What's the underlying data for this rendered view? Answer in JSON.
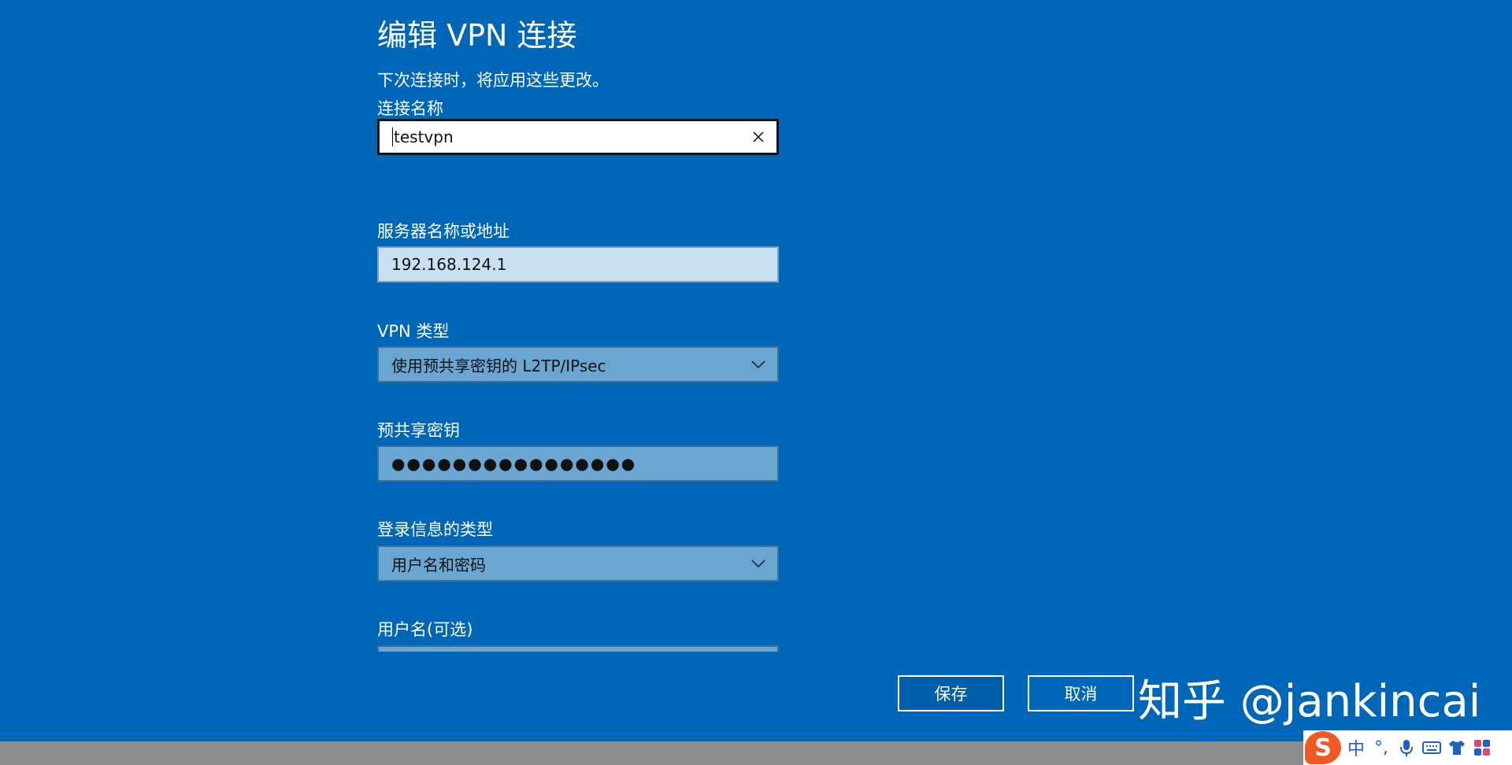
{
  "dialog": {
    "title": "编辑 VPN 连接",
    "subtitle": "下次连接时，将应用这些更改。"
  },
  "fields": {
    "connection_name": {
      "label": "连接名称",
      "value": "testvpn"
    },
    "server": {
      "label": "服务器名称或地址",
      "value": "192.168.124.1"
    },
    "vpn_type": {
      "label": "VPN 类型",
      "value": "使用预共享密钥的 L2TP/IPsec"
    },
    "psk": {
      "label": "预共享密钥",
      "value": "●●●●●●●●●●●●●●●●"
    },
    "signin_type": {
      "label": "登录信息的类型",
      "value": "用户名和密码"
    },
    "username": {
      "label": "用户名(可选)"
    }
  },
  "buttons": {
    "save": "保存",
    "cancel": "取消"
  },
  "watermark": "知乎 @jankincai",
  "ime": {
    "logo": "S",
    "lang": "中",
    "punct": "°,"
  },
  "icons": {
    "clear": "close-icon",
    "dropdown": "chevron-down-icon",
    "mic": "microphone-icon",
    "keyboard": "keyboard-icon",
    "skin": "shirt-icon",
    "toolbox": "grid-icon"
  },
  "colors": {
    "background": "#0067b8",
    "field_light": "#c8e0f0",
    "field_mid": "#6ba5d2",
    "ime_logo": "#f05a22"
  }
}
